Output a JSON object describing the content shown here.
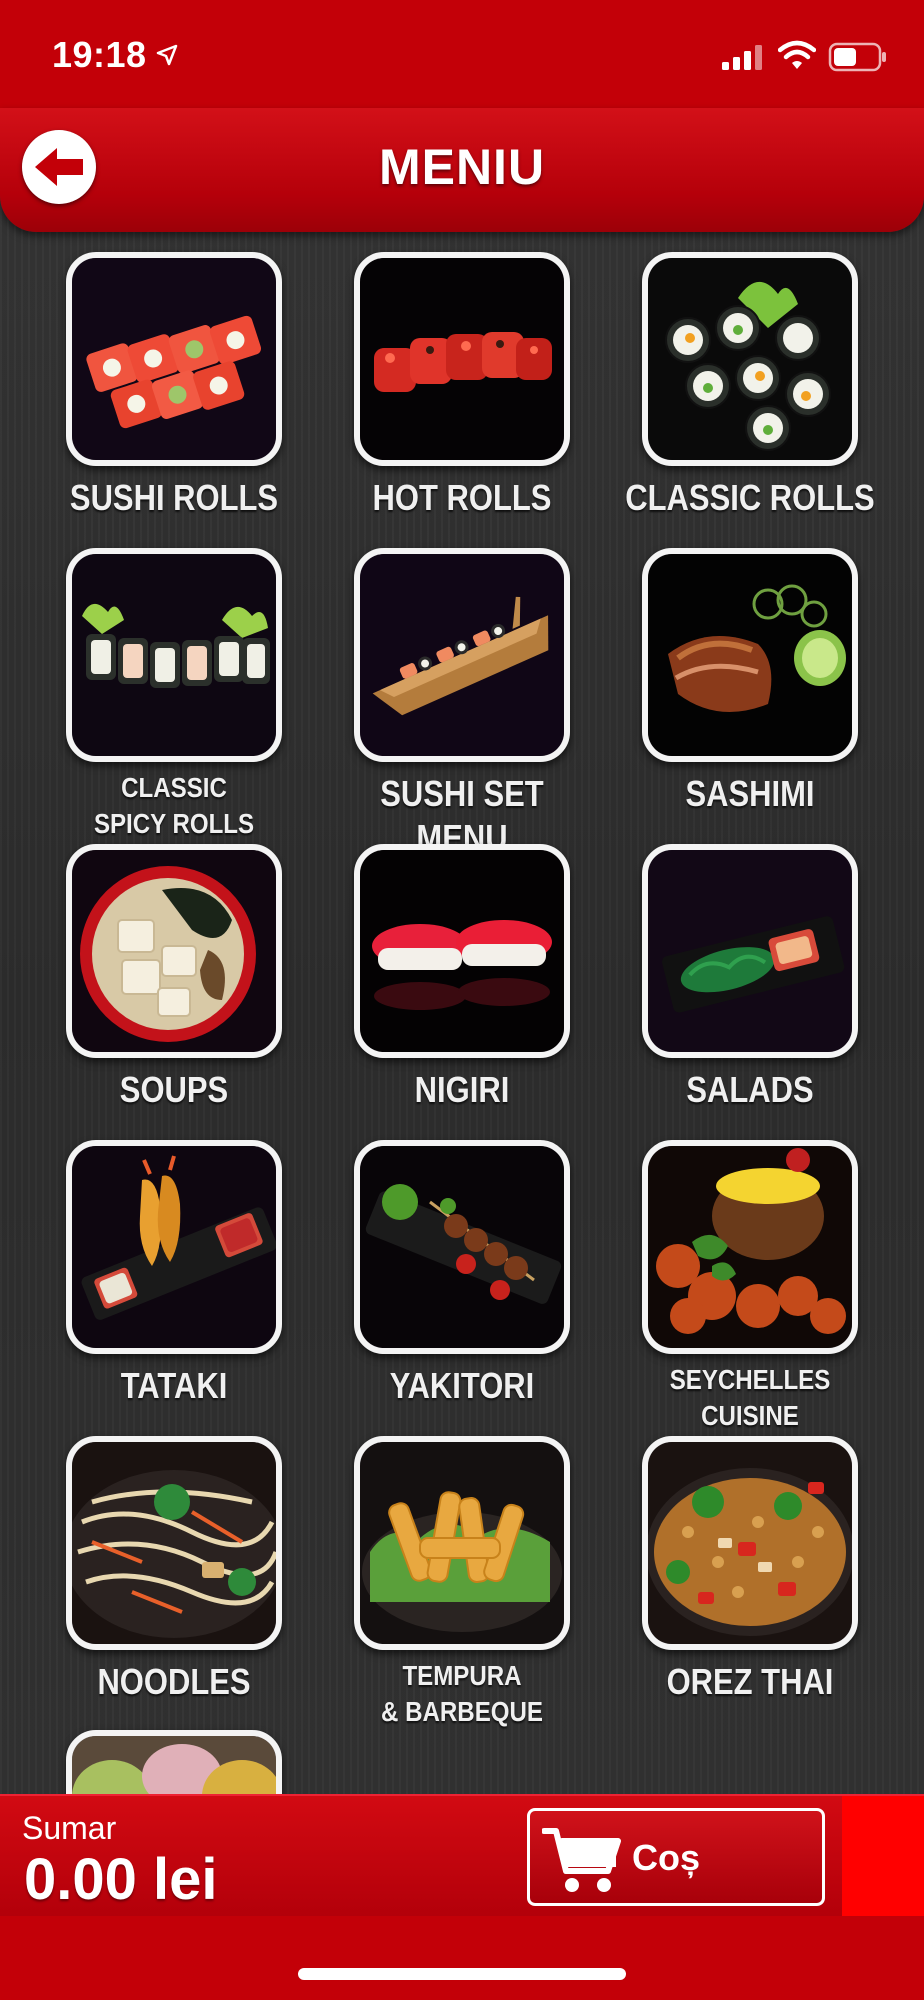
{
  "status_bar": {
    "time": "19:18",
    "icons": [
      "location-arrow-icon",
      "cellular-signal-icon",
      "wifi-icon",
      "battery-icon"
    ]
  },
  "header": {
    "title": "MENIU",
    "back_icon": "back-arrow-icon"
  },
  "categories": [
    {
      "label": "SUSHI ROLLS"
    },
    {
      "label": "HOT ROLLS"
    },
    {
      "label": "CLASSIC ROLLS"
    },
    {
      "label_line1": "CLASSIC",
      "label_line2": "SPICY ROLLS"
    },
    {
      "label": "SUSHI SET MENU"
    },
    {
      "label": "SASHIMI"
    },
    {
      "label": "SOUPS"
    },
    {
      "label": "NIGIRI"
    },
    {
      "label": "SALADS"
    },
    {
      "label": "TATAKI"
    },
    {
      "label": "YAKITORI"
    },
    {
      "label_line1": "SEYCHELLES",
      "label_line2": "CUISINE"
    },
    {
      "label": "NOODLES"
    },
    {
      "label_line1": "TEMPURA",
      "label_line2": "& BARBEQUE"
    },
    {
      "label": "OREZ THAI"
    }
  ],
  "summary": {
    "label": "Sumar",
    "value": "0.00 lei"
  },
  "cart": {
    "label": "Coș",
    "icon": "shopping-cart-icon"
  },
  "colors": {
    "brand_red": "#c30008",
    "accent_red": "#ff0000",
    "background": "#2f2f2f"
  }
}
